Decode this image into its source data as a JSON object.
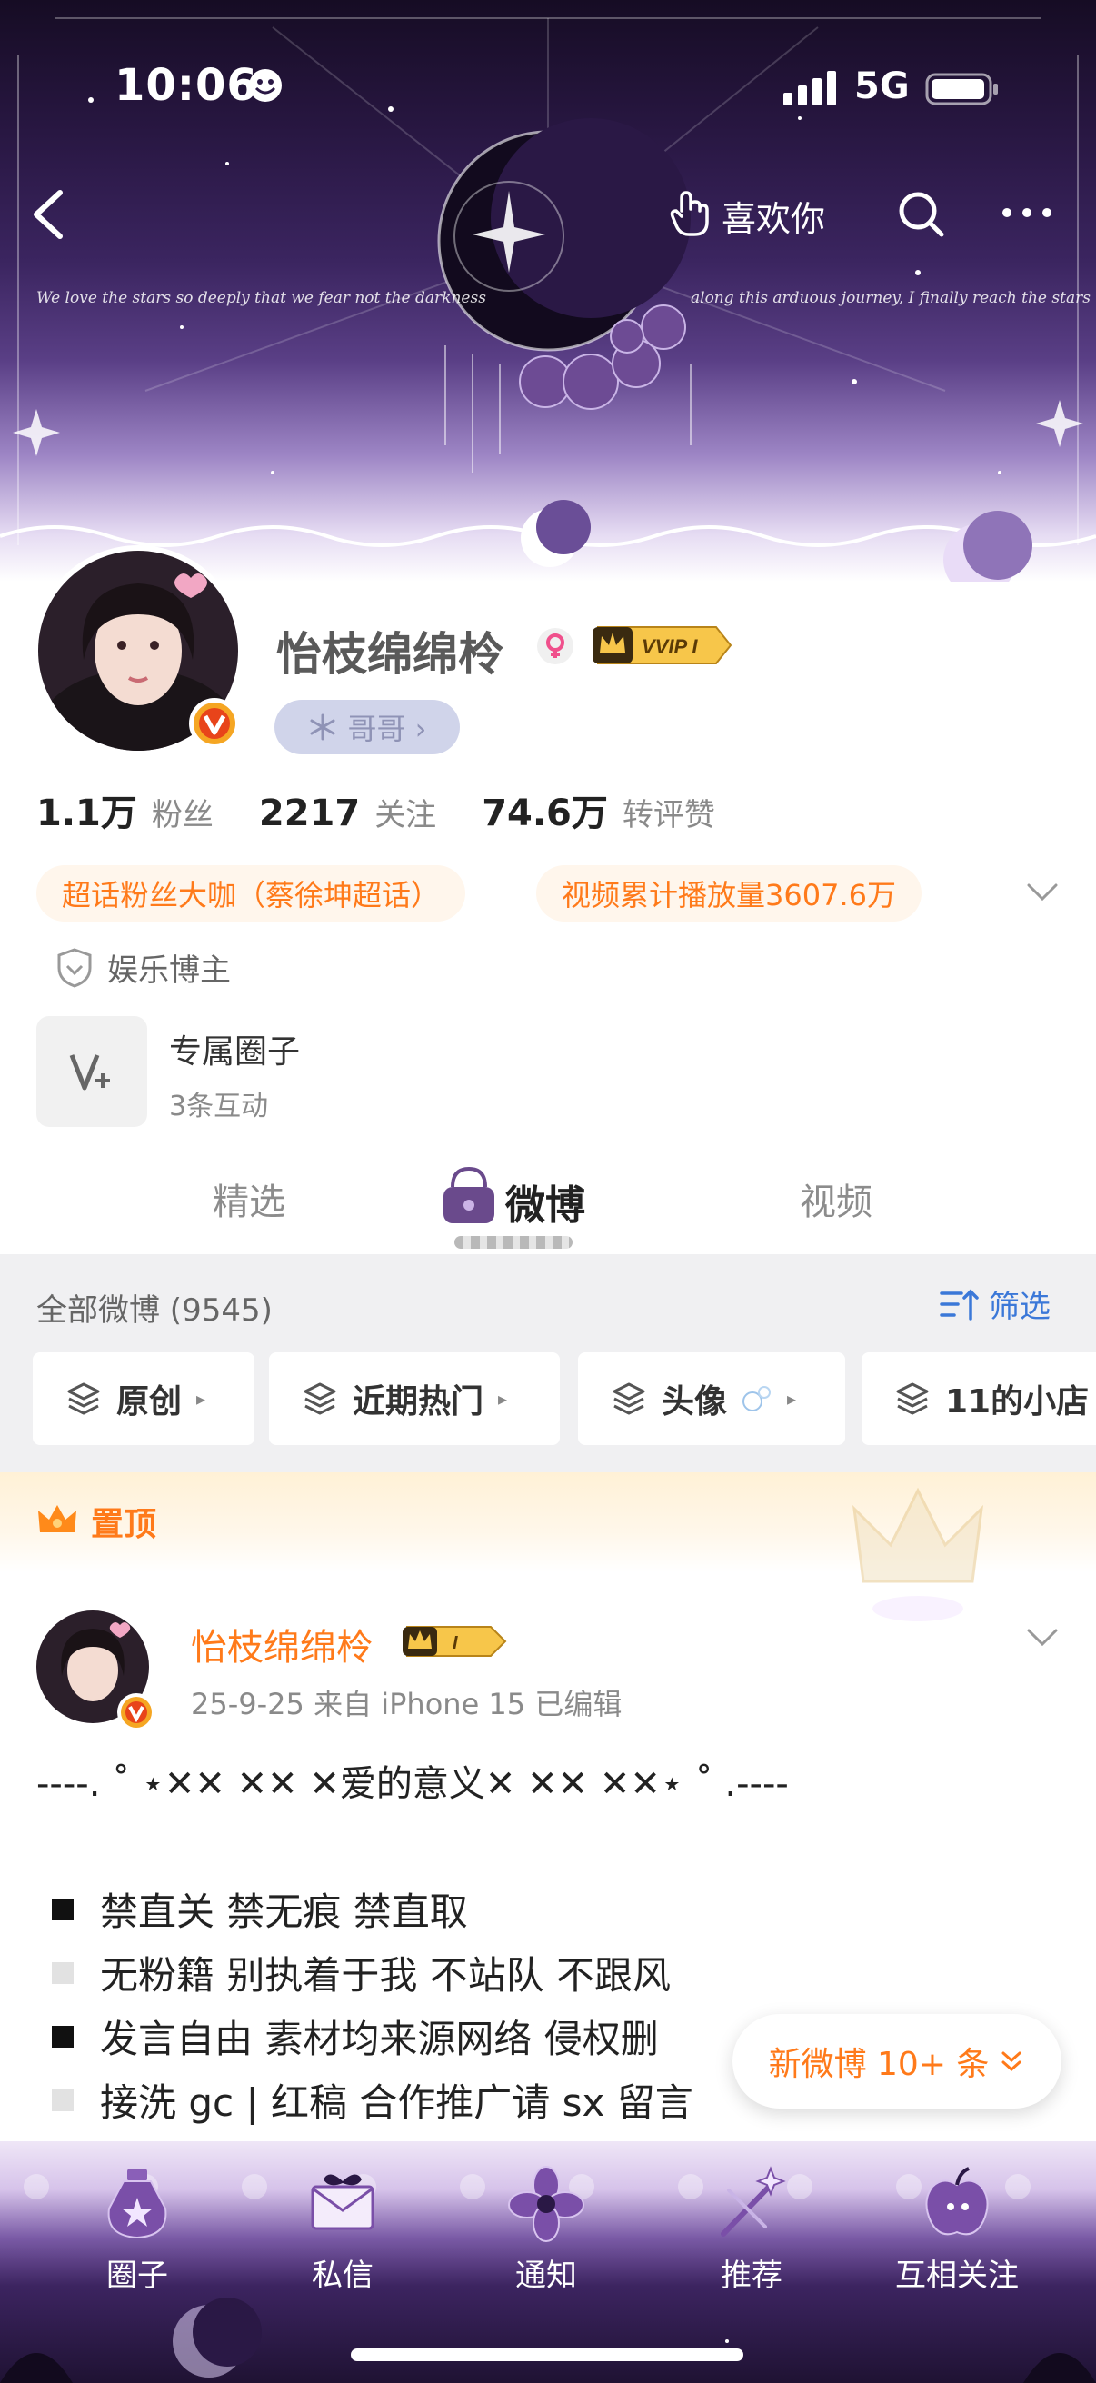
{
  "status_bar": {
    "time": "10:06",
    "network": "5G"
  },
  "header": {
    "like_label": "喜欢你",
    "script_left": "We love the stars so deeply that we fear not the darkness",
    "script_right": "along this arduous journey, I finally reach the stars"
  },
  "profile": {
    "name": "怡枝绵绵柃",
    "vip_label": "VVIP I",
    "title_chip": "哥哥 ›",
    "stats": [
      {
        "num": "1.1万",
        "label": "粉丝"
      },
      {
        "num": "2217",
        "label": "关注"
      },
      {
        "num": "74.6万",
        "label": "转评赞"
      }
    ],
    "tags": [
      "超话粉丝大咖（蔡徐坤超话）",
      "视频累计播放量3607.6万"
    ],
    "blogger_label": "娱乐博主",
    "circle": {
      "title": "专属圈子",
      "subtitle": "3条互动"
    }
  },
  "tabs": [
    "精选",
    "微博",
    "视频"
  ],
  "feed": {
    "header_label": "全部微博 (9545)",
    "filter_label": "筛选",
    "categories": [
      "原创",
      "近期热门",
      "头像",
      "11的小店"
    ],
    "pinned_label": "置顶"
  },
  "post": {
    "author": "怡枝绵绵柃",
    "vip_label": "I",
    "meta": "25-9-25  来自 iPhone 15  已编辑",
    "line1": "----. ˚ ⋆✕✕ ✕✕ ✕爱的意义✕ ✕✕ ✕✕⋆ ˚ .----",
    "rules": [
      {
        "marker": "black",
        "text": "禁直关  禁无痕  禁直取"
      },
      {
        "marker": "white",
        "text": "无粉籍 别执着于我 不站队 不跟风"
      },
      {
        "marker": "black",
        "text": "发言自由 素材均来源网络 侵权删"
      },
      {
        "marker": "white",
        "text": "接洗 gc | 红稿  合作推广请 sx 留言"
      }
    ]
  },
  "new_post_button": "新微博 10+ 条",
  "bottom_nav": [
    "圈子",
    "私信",
    "通知",
    "推荐",
    "互相关注"
  ],
  "colors": {
    "accent": "#ff7a1a",
    "link": "#3b78d8",
    "header_purple": "#3b2560"
  }
}
